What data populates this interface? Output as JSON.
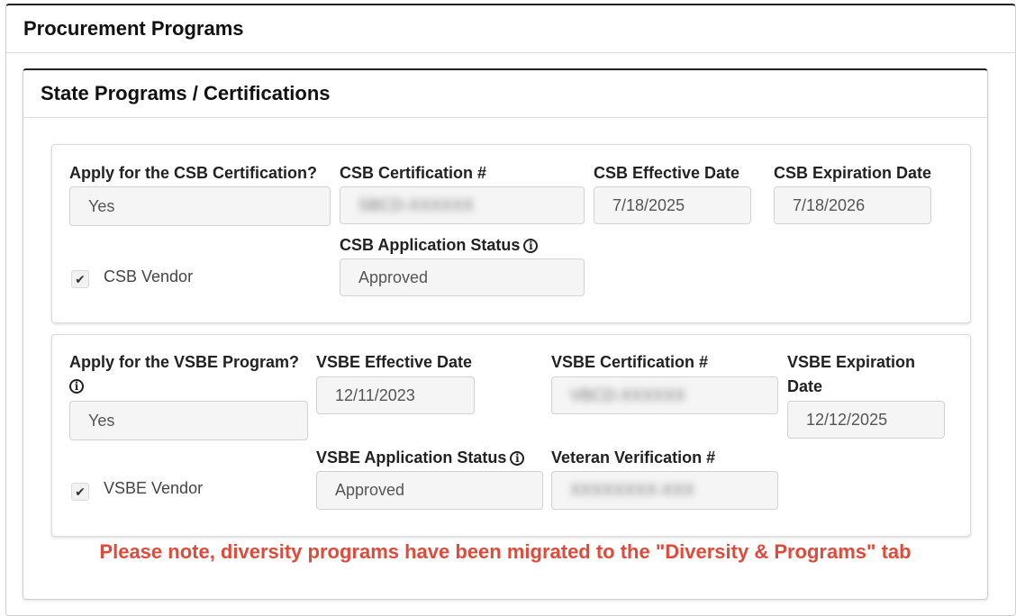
{
  "procurement": {
    "title": "Procurement Programs"
  },
  "state_programs": {
    "title": "State Programs / Certifications"
  },
  "csb": {
    "apply_label": "Apply for the CSB Certification?",
    "apply_value": "Yes",
    "cert_label": "CSB Certification #",
    "cert_value": "SBCD-XXXXXX",
    "effective_label": "CSB Effective Date",
    "effective_value": "7/18/2025",
    "expiration_label": "CSB Expiration Date",
    "expiration_value": "7/18/2026",
    "status_label": "CSB Application Status",
    "status_value": "Approved",
    "vendor_label": "CSB Vendor",
    "vendor_checked": true
  },
  "vsbe": {
    "apply_label": "Apply for the VSBE Program?",
    "apply_value": "Yes",
    "effective_label": "VSBE Effective Date",
    "effective_value": "12/11/2023",
    "cert_label": "VSBE Certification #",
    "cert_value": "VBCD-XXXXXX",
    "expiration_label": "VSBE Expiration Date",
    "expiration_value": "12/12/2025",
    "status_label": "VSBE Application Status",
    "status_value": "Approved",
    "veteran_label": "Veteran Verification #",
    "veteran_value": "XXXXXXXX-XXX",
    "vendor_label": "VSBE Vendor",
    "vendor_checked": true
  },
  "note": {
    "text": "Please note, diversity programs have been migrated to the \"Diversity & Programs\" tab",
    "color": "#e04a3a"
  },
  "icons": {
    "info": "info-icon",
    "check": "check-icon"
  }
}
